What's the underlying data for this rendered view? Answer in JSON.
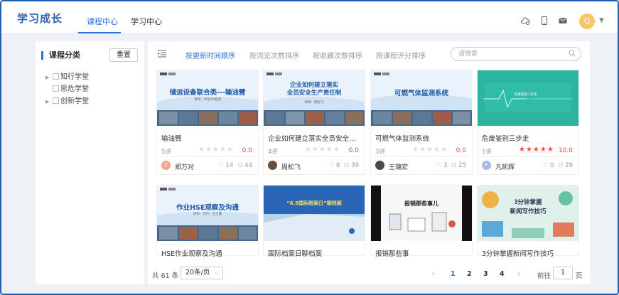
{
  "app": {
    "title": "学习成长"
  },
  "nav": {
    "tabs": [
      {
        "label": "课程中心",
        "active": true
      },
      {
        "label": "学习中心",
        "active": false
      }
    ]
  },
  "user": {
    "avatar_initial": "Q"
  },
  "sidebar": {
    "title": "课程分类",
    "reset_label": "重置",
    "items": [
      {
        "label": "知行学堂",
        "expandable": true
      },
      {
        "label": "思危学堂",
        "expandable": false
      },
      {
        "label": "创新学堂",
        "expandable": true
      }
    ]
  },
  "sort": {
    "options": [
      "按更新时间顺序",
      "按浏览次数排序",
      "按收藏次数排序",
      "按课程评分排序"
    ],
    "active_index": 0
  },
  "search": {
    "placeholder": "请搜索",
    "value": ""
  },
  "courses": [
    {
      "title": "输油臂",
      "thumb_heading": "储运设备联合类---输油臂",
      "thumb_sub": "讲师：中化XX能源",
      "lessons": "5讲",
      "stars_lit": 0,
      "score": "0.0",
      "author": "郑万对",
      "avatar": "Z",
      "avatar_color": "#f3a683",
      "favorites": "14",
      "views": "44"
    },
    {
      "title": "企业如何建立落实全员安全生产责任制",
      "thumb_heading": "企业如何建立落实\n全员安全生产责任制",
      "thumb_sub": "讲师：周松飞",
      "lessons": "4讲",
      "stars_lit": 0,
      "score": "0.0",
      "author": "周松飞",
      "avatar": "",
      "avatar_color": "#6b4f3a",
      "favorites": "6",
      "views": "39"
    },
    {
      "title": "可燃气体监测系统",
      "thumb_heading": "可燃气体监测系统",
      "thumb_sub": "",
      "lessons": "3讲",
      "stars_lit": 0,
      "score": "0.0",
      "author": "王璐宏",
      "avatar": "",
      "avatar_color": "#4a4a4a",
      "favorites": "3",
      "views": "25"
    },
    {
      "title": "危废鉴别三步走",
      "thumb_heading": "危废鉴别三步走",
      "thumb_sub": "",
      "lessons": "1讲",
      "stars_lit": 5,
      "score": "10.0",
      "author": "凡凯辉",
      "avatar": "F",
      "avatar_color": "#a9b8e8",
      "favorites": "0",
      "views": "29"
    },
    {
      "title": "HSE作业观察及沟通",
      "thumb_heading": "作业HSE观察及沟通",
      "thumb_sub": "讲师：吕兴、王立鑫"
    },
    {
      "title": "国际档案日聊档案",
      "thumb_heading": "“6.9国际档案日”聊档案",
      "thumb_sub": ""
    },
    {
      "title": "报销那些事",
      "thumb_heading": "报销那些事儿",
      "thumb_sub": ""
    },
    {
      "title": "3分钟掌握新闻写作技巧",
      "thumb_heading": "3分钟掌握\n新闻写作技巧",
      "thumb_sub": ""
    }
  ],
  "pagination": {
    "total_label": "共 61 条",
    "page_size": "20条/页",
    "pages": [
      "1",
      "2",
      "3",
      "4"
    ],
    "current": "1",
    "goto_label": "前往",
    "goto_value": "1",
    "page_unit": "页"
  },
  "colors": {
    "brand": "#2e5fb6",
    "accent": "#2f6fd6",
    "star": "#ef4b3e"
  }
}
